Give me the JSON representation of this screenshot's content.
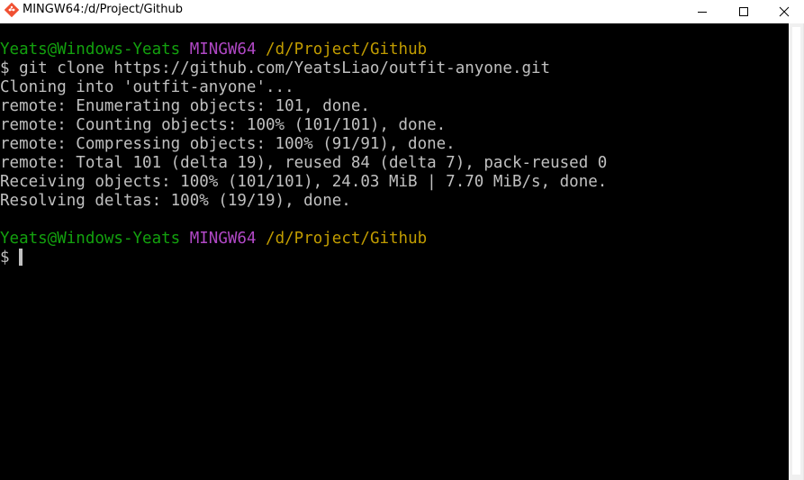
{
  "window": {
    "title": "MINGW64:/d/Project/Github",
    "icon": "git-bash-icon",
    "controls": {
      "minimize": "minimize-icon",
      "maximize": "maximize-icon",
      "close": "close-icon"
    }
  },
  "terminal": {
    "prompt1": {
      "user": "Yeats@Windows-Yeats",
      "shell": "MINGW64",
      "path": "/d/Project/Github"
    },
    "command": "$ git clone https://github.com/YeatsLiao/outfit-anyone.git",
    "output": [
      "Cloning into 'outfit-anyone'...",
      "remote: Enumerating objects: 101, done.",
      "remote: Counting objects: 100% (101/101), done.",
      "remote: Compressing objects: 100% (91/91), done.",
      "remote: Total 101 (delta 19), reused 84 (delta 7), pack-reused 0",
      "Receiving objects: 100% (101/101), 24.03 MiB | 7.70 MiB/s, done.",
      "Resolving deltas: 100% (19/19), done."
    ],
    "prompt2": {
      "user": "Yeats@Windows-Yeats",
      "shell": "MINGW64",
      "path": "/d/Project/Github"
    },
    "input_prompt": "$ "
  },
  "colors": {
    "background": "#000000",
    "text": "#c0c0c0",
    "user": "#13a10e",
    "shell": "#b148c6",
    "path": "#c19c00"
  }
}
